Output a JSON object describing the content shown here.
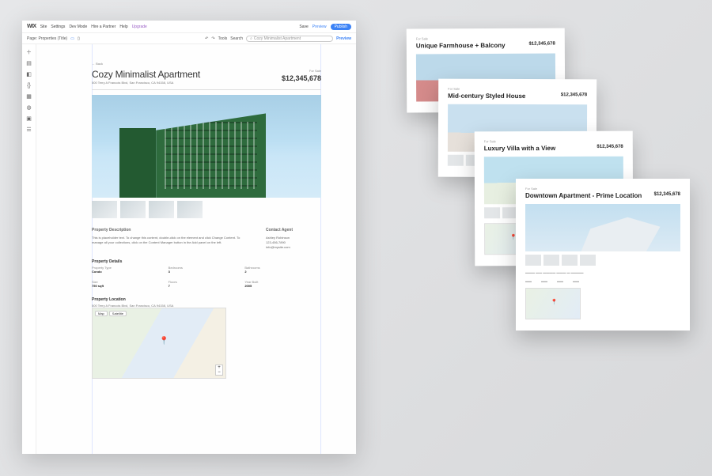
{
  "topbar": {
    "logo": "WIX",
    "menu": [
      "Site",
      "Settings",
      "Dev Mode",
      "Hire a Partner",
      "Help",
      "Upgrade"
    ],
    "right": {
      "save": "Save",
      "preview": "Preview",
      "publish": "Publish"
    }
  },
  "subbar": {
    "page_label": "Page: Properties (Title)",
    "search_placeholder": "Cozy Minimalist Apartment",
    "preview": "Preview",
    "search_btn": "Search",
    "tools": "Tools"
  },
  "rail_icons": [
    "plus",
    "layers",
    "grid",
    "code",
    "apps",
    "database",
    "media",
    "cms"
  ],
  "listing": {
    "back": "← Back",
    "title": "Cozy Minimalist Apartment",
    "address": "500 Terry A Francois Blvd, San Francisco, CA 94158, USA",
    "status": "For Sale",
    "price": "$12,345,678",
    "desc_heading": "Property Description",
    "desc_body": "This is placeholder text. To change this content, double-click on the element and click Change Content. To manage all your collections, click on the Content Manager button in the Add panel on the left.",
    "agent_heading": "Contact Agent",
    "agent_name": "Ashley Robinson",
    "agent_phone": "123-456-7890",
    "agent_email": "info@mysite.com",
    "details_heading": "Property Details",
    "details": [
      {
        "label": "Property Type",
        "value": "Condo"
      },
      {
        "label": "Bedrooms",
        "value": "3"
      },
      {
        "label": "Bathrooms",
        "value": "2"
      },
      {
        "label": "Size",
        "value": "750 sqft"
      },
      {
        "label": "Floors",
        "value": "7"
      },
      {
        "label": "Year Built",
        "value": "2005"
      }
    ],
    "location_heading": "Property Location",
    "location_address": "500 Terry A Francois Blvd, San Francisco, CA 94158, USA",
    "map": {
      "chip1": "Map",
      "chip2": "Satellite"
    }
  },
  "cards": [
    {
      "title": "Unique Farmhouse + Balcony",
      "price": "$12,345,678",
      "status": "For Sale"
    },
    {
      "title": "Mid-century Styled House",
      "price": "$12,345,678",
      "status": "For Sale"
    },
    {
      "title": "Luxury Villa with a View",
      "price": "$12,345,678",
      "status": "For Sale"
    },
    {
      "title": "Downtown Apartment - Prime Location",
      "price": "$12,345,678",
      "status": "For Sale"
    }
  ]
}
